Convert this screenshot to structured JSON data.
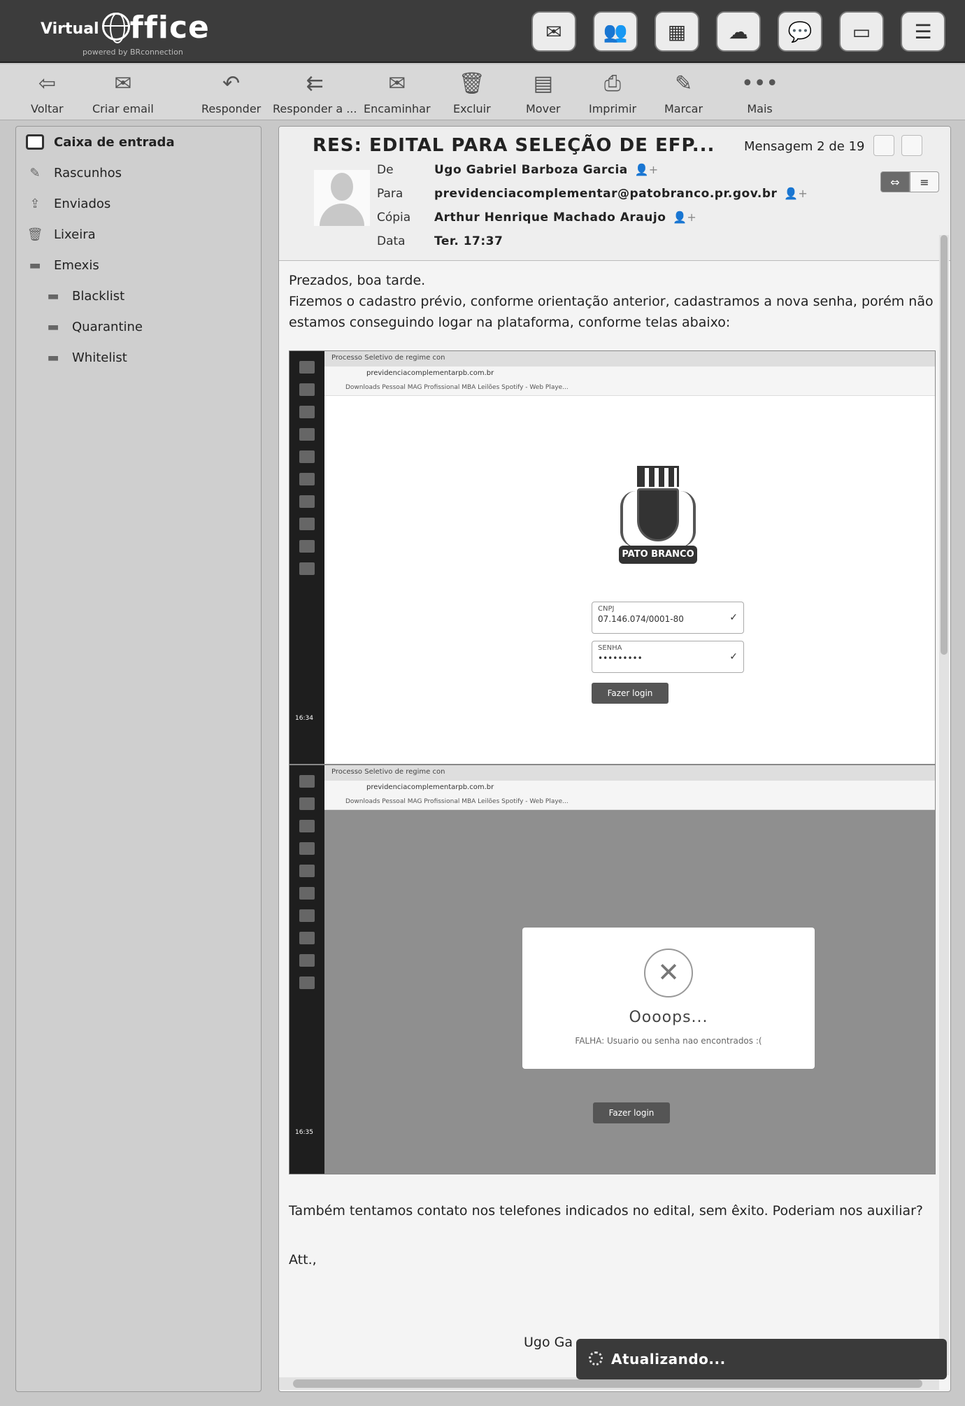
{
  "app": {
    "logo_virtual": "Virtual",
    "logo_ffice": "ffice",
    "powered_by": "powered by BRconnection"
  },
  "topbar_icons": [
    "mail-icon",
    "contacts-icon",
    "calendar-icon",
    "cloud-download-icon",
    "chat-icon",
    "monitor-icon",
    "menu-icon"
  ],
  "toolbar": {
    "back": "Voltar",
    "new_email": "Criar email",
    "reply": "Responder",
    "reply_all": "Responder a ...",
    "forward": "Encaminhar",
    "delete": "Excluir",
    "move": "Mover",
    "print": "Imprimir",
    "mark": "Marcar",
    "more": "Mais"
  },
  "sidebar": {
    "folders": [
      {
        "label": "Caixa de entrada",
        "icon": "inbox-icon"
      },
      {
        "label": "Rascunhos",
        "icon": "pencil-icon"
      },
      {
        "label": "Enviados",
        "icon": "sent-icon"
      },
      {
        "label": "Lixeira",
        "icon": "trash-icon"
      },
      {
        "label": "Emexis",
        "icon": "folder-icon"
      },
      {
        "label": "Blacklist",
        "icon": "folder-icon"
      },
      {
        "label": "Quarantine",
        "icon": "folder-icon"
      },
      {
        "label": "Whitelist",
        "icon": "folder-icon"
      }
    ]
  },
  "message": {
    "subject": "RES: EDITAL PARA SELEÇÃO DE EFP...",
    "counter": "Mensagem 2 de 19",
    "from_label": "De",
    "from": "Ugo Gabriel Barboza Garcia",
    "to_label": "Para",
    "to": "previdenciacomplementar@patobranco.pr.gov.br",
    "cc_label": "Cópia",
    "cc": "Arthur Henrique Machado Araujo",
    "date_label": "Data",
    "date": "Ter. 17:37",
    "greeting": "Prezados, boa tarde.",
    "paragraph1": "Fizemos o cadastro prévio, conforme orientação anterior, cadastramos a nova senha, porém não estamos conseguindo logar na plataforma, conforme telas abaixo:",
    "paragraph2": "Também tentamos contato nos telefones indicados no edital, sem êxito. Poderiam nos auxiliar?",
    "closing": "Att.,",
    "signature": "Ugo Ga"
  },
  "screenshot1": {
    "tab": "Processo Seletivo de regime con",
    "url": "previdenciacomplementarpb.com.br",
    "bookmarks": "Downloads   Pessoal   MAG   Profissional   MBA   Leilões   Spotify - Web Playe...",
    "crest_label": "PATO BRANCO",
    "cnpj_label": "CNPJ",
    "cnpj_value": "07.146.074/0001-80",
    "senha_label": "SENHA",
    "senha_value": "•••••••••",
    "login_btn": "Fazer login",
    "time": "16:34"
  },
  "screenshot2": {
    "tab": "Processo Seletivo de regime con",
    "url": "previdenciacomplementarpb.com.br",
    "bookmarks": "Downloads   Pessoal   MAG   Profissional   MBA   Leilões   Spotify - Web Playe...",
    "modal_title": "Oooops...",
    "modal_msg": "FALHA: Usuario ou senha nao encontrados :(",
    "login_btn": "Fazer login",
    "time": "16:35"
  },
  "status": "Atualizando..."
}
